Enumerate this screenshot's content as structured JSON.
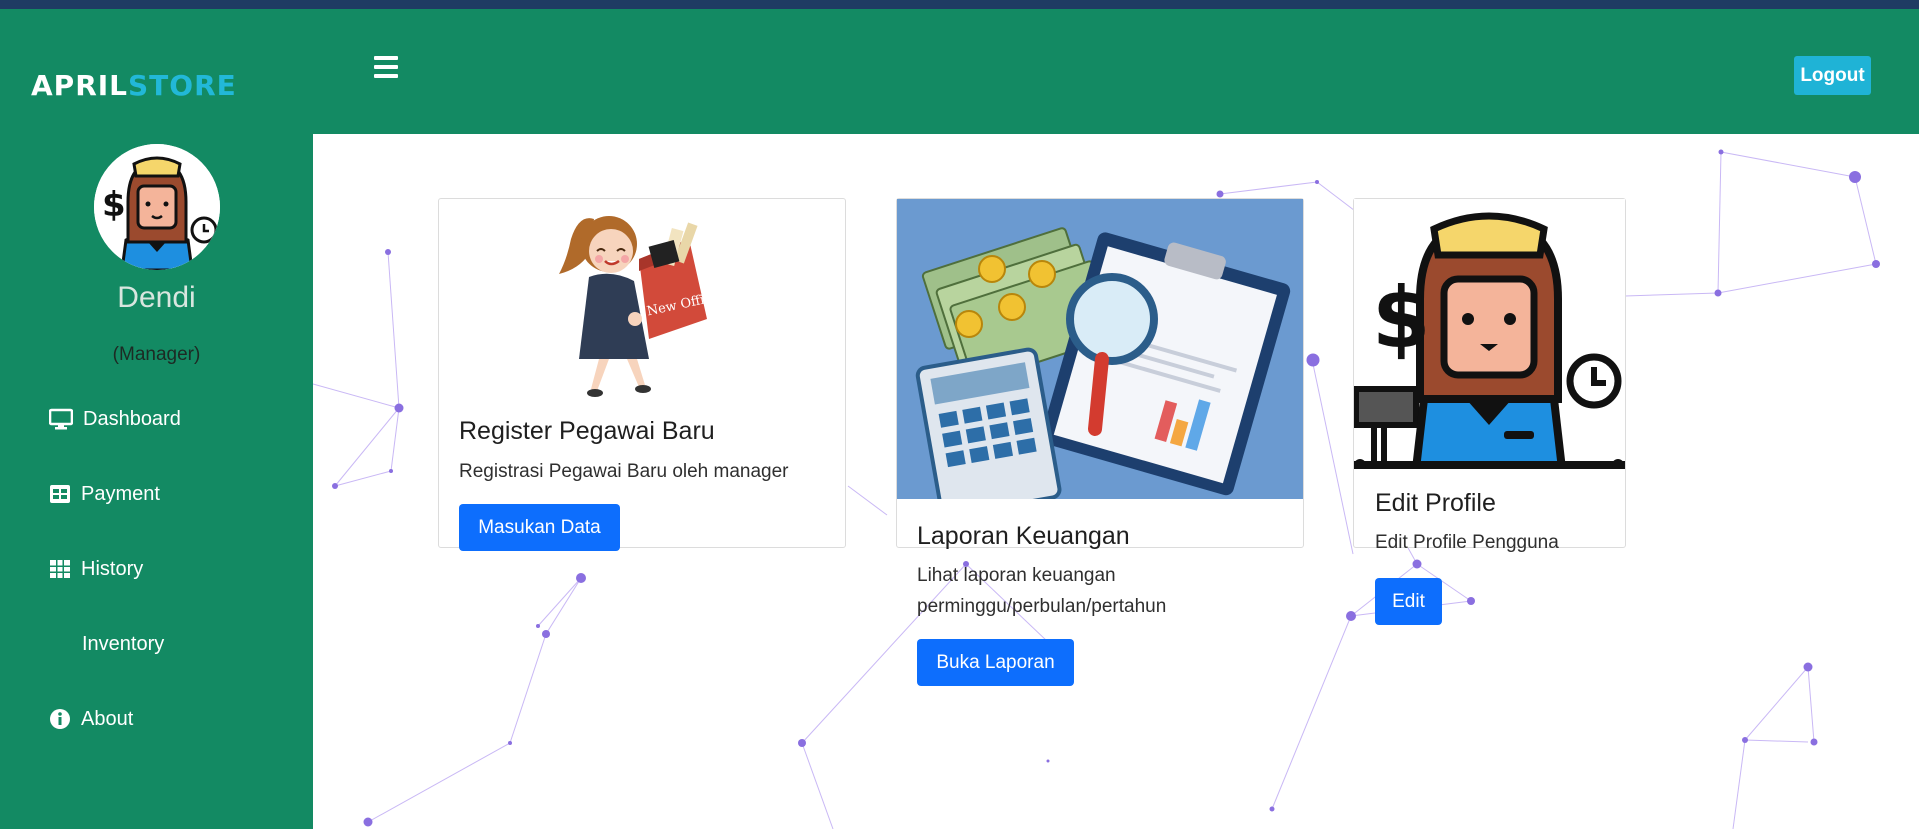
{
  "brand": {
    "part1": "APRIL",
    "part2": "STORE"
  },
  "user": {
    "name": "Dendi",
    "role": "(Manager)"
  },
  "sidebar": {
    "items": [
      {
        "label": "Dashboard",
        "icon": "monitor-icon"
      },
      {
        "label": "Payment",
        "icon": "table-icon"
      },
      {
        "label": "History",
        "icon": "grid-icon"
      },
      {
        "label": "Inventory",
        "icon": ""
      },
      {
        "label": "About",
        "icon": "info-icon"
      }
    ]
  },
  "header": {
    "logout_label": "Logout"
  },
  "cards": [
    {
      "title": "Register Pegawai Baru",
      "text": "Registrasi Pegawai Baru oleh manager",
      "button": "Masukan Data",
      "image_caption": "New Office"
    },
    {
      "title": "Laporan Keuangan",
      "text_line1": "Lihat laporan keuangan",
      "text_line2": "perminggu/perbulan/pertahun",
      "button": "Buka Laporan"
    },
    {
      "title": "Edit Profile",
      "text": "Edit Profile Pengguna",
      "button": "Edit"
    }
  ],
  "colors": {
    "sidebar": "#138a63",
    "accent": "#22b8d8",
    "primary_button": "#0d6efd",
    "logout_button": "#1fb3d6"
  }
}
